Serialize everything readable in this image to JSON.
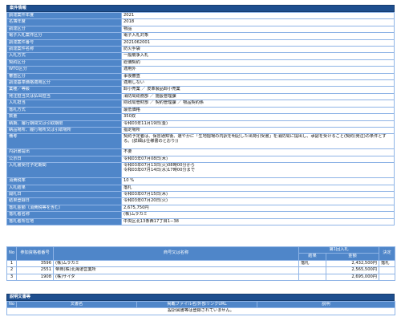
{
  "case_info": {
    "title": "案件情報",
    "rows": [
      {
        "label": "調達案件年度",
        "value": "2021"
      },
      {
        "label": "名簿年度",
        "value": "2018"
      },
      {
        "label": "調達区分",
        "value": "物品"
      },
      {
        "label": "電子入札案件区分",
        "value": "電子入札対象"
      },
      {
        "label": "調達案件番号",
        "value": "2021062001"
      },
      {
        "label": "調達案件名称",
        "value": "防火手袋"
      },
      {
        "label": "入札方式",
        "value": "一般競争入札"
      },
      {
        "label": "契約区分",
        "value": "総価契約"
      },
      {
        "label": "WTO区分",
        "value": "適用外"
      },
      {
        "label": "審査区分",
        "value": "事後審査"
      },
      {
        "label": "調達基準価格適用区分",
        "value": "適用しない"
      },
      {
        "label": "業種／等級",
        "value": "卸小売業 ／ 皮革製品卸小売業"
      },
      {
        "label": "発注担当又は払出担当",
        "value": "消防局総務部 ／ 施設管理課"
      },
      {
        "label": "入札担当",
        "value": "財政局管財部 ／ 契約管理課 ／ 物品契約係"
      },
      {
        "label": "落札方式",
        "value": "最低価格"
      },
      {
        "label": "数量",
        "value": "350双"
      },
      {
        "label": "納期、履行期間又は引取期限",
        "value": "令和03年11月19日(金)"
      },
      {
        "label": "納品場所、履行場所又は引取場所",
        "value": "指定場所"
      },
      {
        "label": "備考",
        "value": "契約予定者は、保冒通知後、速やかに「生地摺場の内訳を明記した出荷引受書」を消防局に提出し、承認を受けること(契約(発注)の条件とする。(詳細は仕様書のとおり))",
        "tall": true
      },
      {
        "label": "内訳書提出",
        "value": "不要"
      },
      {
        "label": "公示日",
        "value": "令和03年07月08日(木)"
      },
      {
        "label": "入札書受付予定期間",
        "value": "令和03年07月13日(火)08時00分から\n令和03年07月14日(水)17時00分まで",
        "tall": true
      },
      {
        "label": "消費税率",
        "value": "10 %"
      },
      {
        "label": "入札結果",
        "value": "落札"
      },
      {
        "label": "開札日",
        "value": "令和03年07月15日(木)"
      },
      {
        "label": "結果登録日",
        "value": "令和03年07月20日(火)"
      },
      {
        "label": "落札金額（消費税等を含む）",
        "value": "2,675,750円"
      },
      {
        "label": "落札者名称",
        "value": "(株)ムラカミ"
      },
      {
        "label": "落札者所在地",
        "value": "中央区北13条西17丁目1−38"
      }
    ]
  },
  "bids": {
    "headers": {
      "no": "No",
      "reg_no": "参加資格者番号",
      "name": "商号又は名称",
      "round": "第1回入札",
      "result": "結果",
      "amount": "金額",
      "decision": "決定"
    },
    "rows": [
      {
        "no": "1",
        "reg_no": "3596",
        "name": "(株)ムラカミ",
        "result": "落札",
        "amount": "2,432,500円",
        "decision": "落札"
      },
      {
        "no": "2",
        "reg_no": "2551",
        "name": "帝商(株)北海道営業所",
        "result": "",
        "amount": "2,565,500円",
        "decision": ""
      },
      {
        "no": "3",
        "reg_no": "1908",
        "name": "(株)サイダ",
        "result": "",
        "amount": "2,695,000円",
        "decision": ""
      }
    ]
  },
  "docs": {
    "title": "説明文書等",
    "headers": {
      "no": "No",
      "name": "文書名",
      "file": "掲載ファイル名/外部リンクURL",
      "desc": "説明"
    },
    "empty_message": "設計図書等は登録されていません。"
  }
}
